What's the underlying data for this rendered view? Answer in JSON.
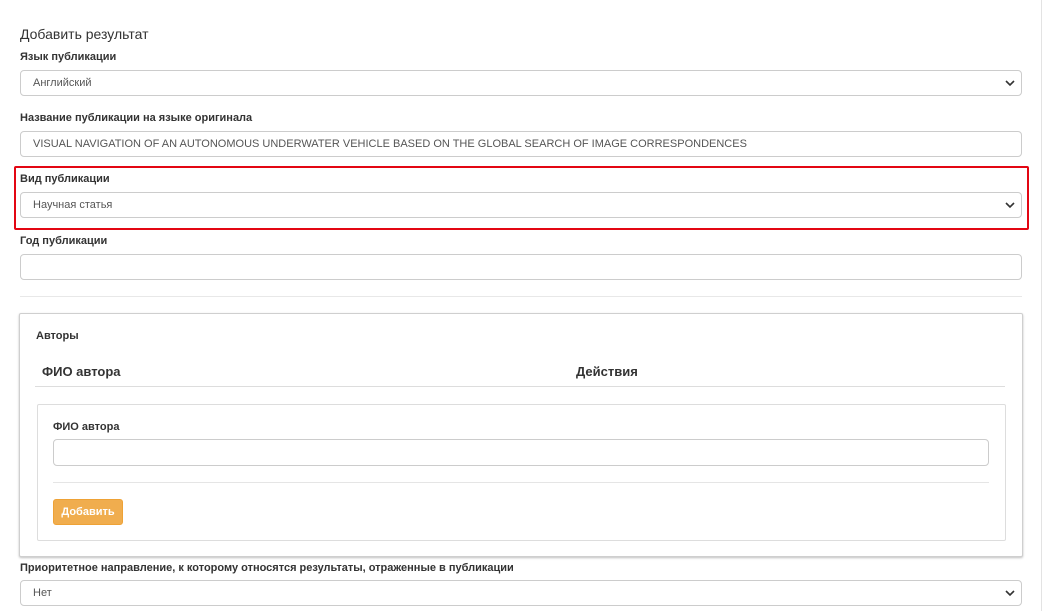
{
  "form": {
    "title": "Добавить результат",
    "language": {
      "label": "Язык публикации",
      "value": "Английский"
    },
    "original_title": {
      "label": "Название публикации на языке оригинала",
      "value": "VISUAL NAVIGATION OF AN AUTONOMOUS UNDERWATER VEHICLE BASED ON THE GLOBAL SEARCH OF IMAGE CORRESPONDENCES"
    },
    "publication_type": {
      "label": "Вид публикации",
      "value": "Научная статья"
    },
    "year": {
      "label": "Год публикации",
      "value": ""
    },
    "authors": {
      "title": "Авторы",
      "columns": [
        "ФИО автора",
        "Действия"
      ],
      "new_author": {
        "label": "ФИО автора",
        "value": ""
      },
      "add_button": "Добавить"
    },
    "priority": {
      "label": "Приоритетное направление, к которому относятся результаты, отраженные в публикации",
      "value": "Нет"
    }
  },
  "colors": {
    "highlight": "#e30613",
    "add_button": "#f0ad4e"
  },
  "icons": {
    "select_arrow": "chevron-down-icon"
  }
}
